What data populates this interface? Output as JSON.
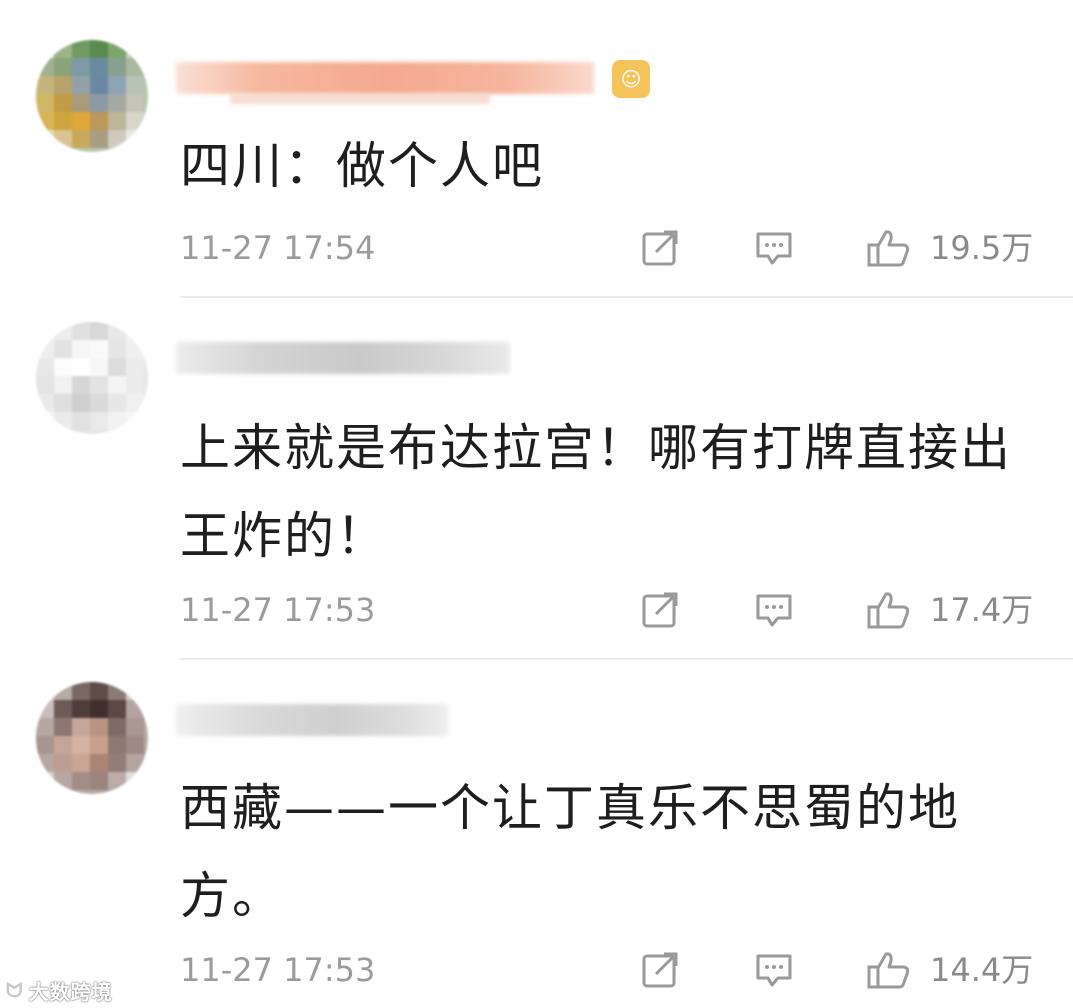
{
  "comments": [
    {
      "text": "四川：做个人吧",
      "time": "11-27 17:54",
      "likes": "19.5万",
      "has_vip_badge": true
    },
    {
      "text": "上来就是布达拉宫！哪有打牌直接出王炸的！",
      "time": "11-27 17:53",
      "likes": "17.4万",
      "has_vip_badge": false
    },
    {
      "text": "西藏——一个让丁真乐不思蜀的地方。",
      "time": "11-27 17:53",
      "likes": "14.4万",
      "has_vip_badge": false
    }
  ],
  "icons": {
    "repost": "repost-icon",
    "comment": "comment-icon",
    "like": "thumbs-up-icon"
  },
  "watermark": {
    "text": "大数跨境"
  },
  "colors": {
    "text": "#1e1e1e",
    "meta": "#9b9b9b",
    "divider": "#ececec",
    "vip_badge": "#f4c45a"
  }
}
